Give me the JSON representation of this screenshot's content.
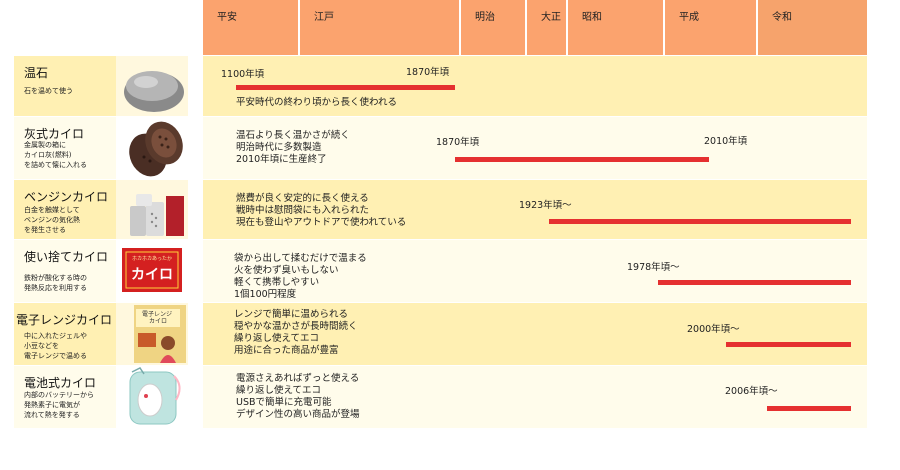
{
  "eras": [
    "平安",
    "江戸",
    "明治",
    "大正",
    "昭和",
    "平成",
    "令和"
  ],
  "rows": [
    {
      "name": "温石",
      "desc": "石を温めて使う",
      "start_label": "1100年頃",
      "end_label": "1870年頃",
      "notes": "平安時代の終わり頃から長く使われる",
      "icon": "stone-icon"
    },
    {
      "name": "灰式カイロ",
      "desc": "金属製の箱に\nカイロ灰(燃料)\nを詰めて懐に入れる",
      "start_label": "1870年頃",
      "end_label": "2010年頃",
      "notes": "温石より長く温かさが続く\n明治時代に多数製造\n2010年頃に生産終了",
      "icon": "ash-warmer-icon"
    },
    {
      "name": "ベンジンカイロ",
      "desc": "白金を触媒として\nベンジンの気化熱\nを発生させる",
      "start_label": "1923年頃〜",
      "end_label": "",
      "notes": "燃費が良く安定的に長く使える\n戦時中は慰問袋にも入れられた\n現在も登山やアウトドアで使われている",
      "icon": "benzine-warmer-icon"
    },
    {
      "name": "使い捨てカイロ",
      "desc": "鉄粉が酸化する時の\n発熱反応を利用する",
      "start_label": "1978年頃〜",
      "end_label": "",
      "notes": "袋から出して揉むだけで温まる\n火を使わず臭いもしない\n軽くて携帯しやすい\n1個100円程度",
      "icon": "disposable-warmer-icon",
      "image_text": {
        "small": "ホカホカあったか",
        "big": "カイロ"
      }
    },
    {
      "name": "電子レンジカイロ",
      "desc": "中に入れたジェルや\n小豆などを\n電子レンジで温める",
      "start_label": "2000年頃〜",
      "end_label": "",
      "notes": "レンジで簡単に温められる\n穏やかな温かさが長時間続く\n繰り返し使えてエコ\n用途に合った商品が豊富",
      "icon": "microwave-warmer-icon",
      "image_text": {
        "big": "電子レンジ\nカイロ"
      }
    },
    {
      "name": "電池式カイロ",
      "desc": "内部のバッテリーから\n発熱素子に電気が\n流れて熱を発する",
      "start_label": "2006年頃〜",
      "end_label": "",
      "notes": "電源さえあればずっと使える\n繰り返し使えてエコ\nUSBで簡単に充電可能\nデザイン性の高い商品が登場",
      "icon": "battery-warmer-icon"
    }
  ]
}
